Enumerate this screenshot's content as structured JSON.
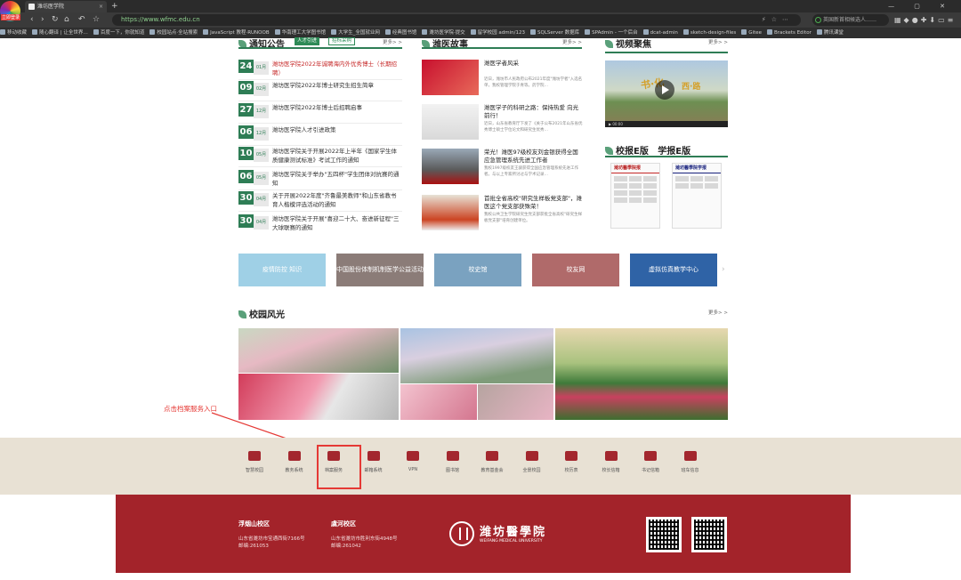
{
  "browser": {
    "badge": "立即登录",
    "tab_title": "潍坊医学院",
    "new_tab": "+",
    "url": "https://www.wfmc.edu.cn",
    "search_placeholder": "英国新首相候选人……",
    "bookmarks": [
      "移动收藏",
      "随心翻译 | 让全世界…",
      "百度一下，你就知道",
      "校园站点·全站搜索",
      "JavaScript 教程·RUNOOB",
      "华南理工大学图书馆",
      "大学生_全国就业网",
      "经典图书馆",
      "潍坊医学院·提交",
      "留学校园 admin/123",
      "SQLServer 数据库",
      "SPAdmin - 一个后台",
      "dcat-admin",
      "sketch-design-files",
      "Gitee",
      "Brackets Editor",
      "腾讯课堂"
    ]
  },
  "notices": {
    "heading": "通知公告",
    "tabs": [
      "人才引进",
      "招标采购"
    ],
    "more": "更多> >",
    "items": [
      {
        "day": "24",
        "month": "01月",
        "title": "潍坊医学院2022年诚聘海内外优秀博士（长期招聘）",
        "highlight": true
      },
      {
        "day": "09",
        "month": "02月",
        "title": "潍坊医学院2022年博士研究生招生简章",
        "highlight": false
      },
      {
        "day": "27",
        "month": "12月",
        "title": "潍坊医学院2022年博士后招聘启事",
        "highlight": false
      },
      {
        "day": "06",
        "month": "12月",
        "title": "潍坊医学院人才引进政策",
        "highlight": false
      },
      {
        "day": "10",
        "month": "05月",
        "title": "潍坊医学院关于开展2022年上半年《国家学生体质健康测试标准》考试工作的通知",
        "highlight": false
      },
      {
        "day": "06",
        "month": "05月",
        "title": "潍坊医学院关于举办\"五四杯\"学生团体对抗赛的通知",
        "highlight": false
      },
      {
        "day": "30",
        "month": "04月",
        "title": "关于开展2022年度\"齐鲁最美教师\"和山东省教书育人楷模评选活动的通知",
        "highlight": false
      },
      {
        "day": "30",
        "month": "04月",
        "title": "潍坊医学院关于开展\"喜迎二十大、奋进新征程\"三大球联赛的通知",
        "highlight": false
      }
    ]
  },
  "stories": {
    "heading": "潍医故事",
    "more": "更多> >",
    "items": [
      {
        "title": "潍医学者风采",
        "desc": "近日，潍坊市人民政府公布2021年度\"潍坊学者\"入选名单，我校管理学院于青等。药学院…"
      },
      {
        "title": "潍医学子的科研之路：保持热爱 向光前行！",
        "desc": "近日，山东省教育厅下发了《关于公布2021年山东省优秀博士硕士学位论文和研究生优秀…"
      },
      {
        "title": "荣光！潍医97级校友刘金银获得全国应急管理系统先进工作者",
        "desc": "我校1997级校友王骏获得全国应急管理系统先进工作者。与以上专家所讨过与学术记录…"
      },
      {
        "title": "首批全省高校\"研究生样板党支部\"，潍医这个党支部获殊荣！",
        "desc": "我校公共卫生学院研究生党支部获批全省高校\"研究生样板党支部\"培育创建单位。"
      }
    ]
  },
  "video": {
    "heading": "视频聚焦",
    "more": "更多> >",
    "caption_a": "书·化",
    "caption_b": "西·路",
    "time": "00:00"
  },
  "epaper": {
    "heading_a": "校报E版",
    "heading_b": "学报E版",
    "paper_a": "潍坊醫學院报",
    "paper_b": "潍坊醫學院学报"
  },
  "banners": [
    {
      "label": "疫情防控 知识",
      "color": "#9fd0e6"
    },
    {
      "label": "中国股份体制机制医学公益活动",
      "color": "#8b7c78"
    },
    {
      "label": "校史馆",
      "color": "#7aa2c0"
    },
    {
      "label": "校友网",
      "color": "#b06a6a"
    },
    {
      "label": "虚拟仿真教学中心",
      "color": "#2f63a6"
    }
  ],
  "gallery": {
    "heading": "校园风光",
    "more": "更多> >"
  },
  "annotation": "点击档案服务入口",
  "services": [
    {
      "label": "智慧校园",
      "icon": "database-icon"
    },
    {
      "label": "教务系统",
      "icon": "book-icon"
    },
    {
      "label": "档案服务",
      "icon": "monitor-icon"
    },
    {
      "label": "邮箱系统",
      "icon": "mail-open-icon"
    },
    {
      "label": "VPN",
      "icon": "vpn-icon"
    },
    {
      "label": "图书馆",
      "icon": "library-icon"
    },
    {
      "label": "教育基金会",
      "icon": "graduation-cap-icon"
    },
    {
      "label": "全景校园",
      "icon": "location-icon"
    },
    {
      "label": "校历表",
      "icon": "calendar-icon"
    },
    {
      "label": "校长信箱",
      "icon": "envelope-icon"
    },
    {
      "label": "书记信箱",
      "icon": "letter-icon"
    },
    {
      "label": "班车信息",
      "icon": "bus-icon"
    }
  ],
  "footer": {
    "campus1": {
      "name": "浮烟山校区",
      "addr": "山东省潍坊市宝通西街7166号",
      "post": "邮编:261053"
    },
    "campus2": {
      "name": "虞河校区",
      "addr": "山东省潍坊市胜利东街4948号",
      "post": "邮编:261042"
    },
    "school_cn": "潍坊醫學院",
    "school_en": "WEIFANG MEDICAL UNIVERSITY"
  }
}
